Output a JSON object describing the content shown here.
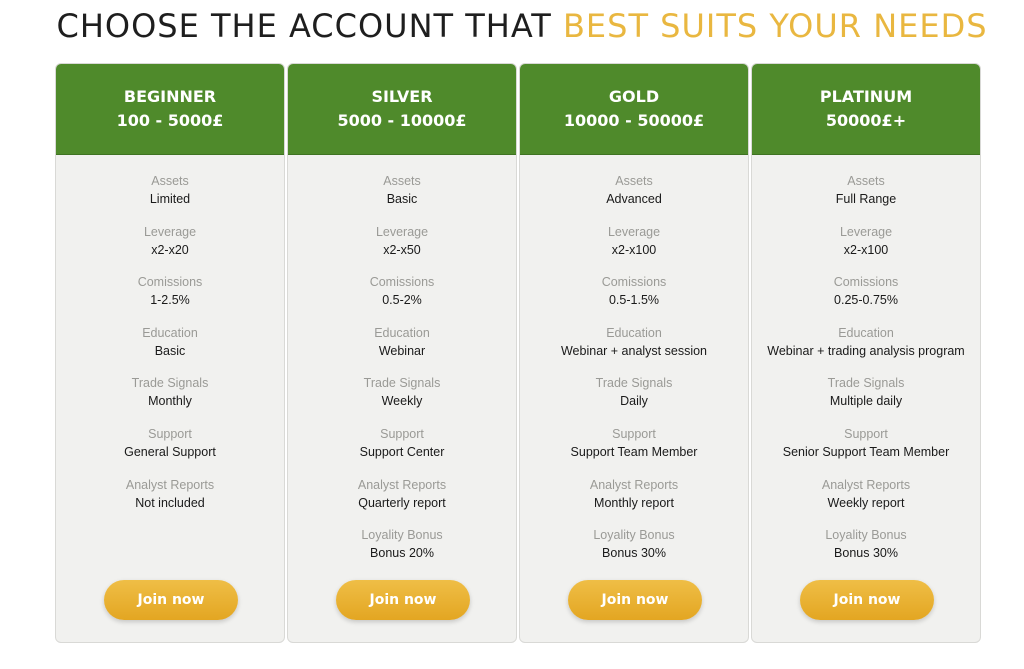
{
  "heading": {
    "part1": "CHOOSE THE ACCOUNT THAT",
    "part2": "BEST SUITS YOUR NEEDS"
  },
  "colors": {
    "header_green": "#4f8a2b",
    "accent_gold": "#e9b740",
    "card_bg": "#f1f1ef"
  },
  "plans": [
    {
      "name": "BEGINNER",
      "range": "100 - 5000£",
      "features": [
        {
          "label": "Assets",
          "value": "Limited"
        },
        {
          "label": "Leverage",
          "value": "x2-x20"
        },
        {
          "label": "Comissions",
          "value": "1-2.5%"
        },
        {
          "label": "Education",
          "value": "Basic"
        },
        {
          "label": "Trade Signals",
          "value": "Monthly"
        },
        {
          "label": "Support",
          "value": "General Support"
        },
        {
          "label": "Analyst Reports",
          "value": "Not included"
        }
      ],
      "button": "Join now"
    },
    {
      "name": "SILVER",
      "range": "5000 - 10000£",
      "features": [
        {
          "label": "Assets",
          "value": "Basic"
        },
        {
          "label": "Leverage",
          "value": "x2-x50"
        },
        {
          "label": "Comissions",
          "value": "0.5-2%"
        },
        {
          "label": "Education",
          "value": "Webinar"
        },
        {
          "label": "Trade Signals",
          "value": "Weekly"
        },
        {
          "label": "Support",
          "value": "Support Center"
        },
        {
          "label": "Analyst Reports",
          "value": "Quarterly report"
        },
        {
          "label": "Loyality Bonus",
          "value": "Bonus 20%"
        }
      ],
      "button": "Join now"
    },
    {
      "name": "GOLD",
      "range": "10000 - 50000£",
      "features": [
        {
          "label": "Assets",
          "value": "Advanced"
        },
        {
          "label": "Leverage",
          "value": "x2-x100"
        },
        {
          "label": "Comissions",
          "value": "0.5-1.5%"
        },
        {
          "label": "Education",
          "value": "Webinar + analyst session"
        },
        {
          "label": "Trade Signals",
          "value": "Daily"
        },
        {
          "label": "Support",
          "value": "Support Team Member"
        },
        {
          "label": "Analyst Reports",
          "value": "Monthly report"
        },
        {
          "label": "Loyality Bonus",
          "value": "Bonus 30%"
        }
      ],
      "button": "Join now"
    },
    {
      "name": "PLATINUM",
      "range": "50000£+",
      "features": [
        {
          "label": "Assets",
          "value": "Full Range"
        },
        {
          "label": "Leverage",
          "value": "x2-x100"
        },
        {
          "label": "Comissions",
          "value": "0.25-0.75%"
        },
        {
          "label": "Education",
          "value": "Webinar + trading analysis program"
        },
        {
          "label": "Trade Signals",
          "value": "Multiple daily"
        },
        {
          "label": "Support",
          "value": "Senior Support Team Member"
        },
        {
          "label": "Analyst Reports",
          "value": "Weekly report"
        },
        {
          "label": "Loyality Bonus",
          "value": "Bonus 30%"
        }
      ],
      "button": "Join now"
    }
  ]
}
